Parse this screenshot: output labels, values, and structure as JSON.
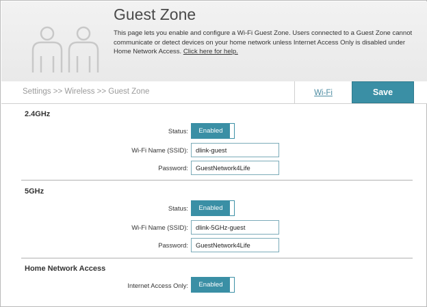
{
  "header": {
    "title": "Guest Zone",
    "description": "This page lets you enable and configure a Wi-Fi Guest Zone. Users connected to a Guest Zone cannot communicate or detect devices on your home network unless Internet Access Only is disabled under Home Network Access.",
    "help_link": "Click here for help."
  },
  "nav": {
    "breadcrumb": "Settings >> Wireless >> Guest Zone",
    "wifi_link": "Wi-Fi",
    "save_label": "Save"
  },
  "band_24": {
    "title": "2.4GHz",
    "status_label": "Status:",
    "status_value": "Enabled",
    "ssid_label": "Wi-Fi Name (SSID):",
    "ssid_value": "dlink-guest",
    "password_label": "Password:",
    "password_value": "GuestNetwork4Life"
  },
  "band_5": {
    "title": "5GHz",
    "status_label": "Status:",
    "status_value": "Enabled",
    "ssid_label": "Wi-Fi Name (SSID):",
    "ssid_value": "dlink-5GHz-guest",
    "password_label": "Password:",
    "password_value": "GuestNetwork4Life"
  },
  "home_access": {
    "title": "Home Network Access",
    "internet_only_label": "Internet Access Only:",
    "internet_only_value": "Enabled"
  },
  "colors": {
    "accent": "#3a8fa5",
    "header_bg": "#eeeeee"
  }
}
